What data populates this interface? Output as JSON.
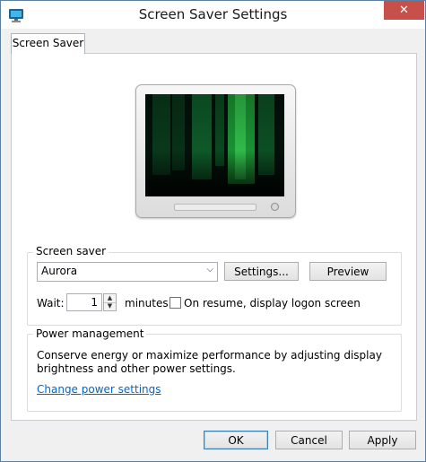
{
  "window": {
    "title": "Screen Saver Settings",
    "close_label": "✕"
  },
  "tabs": [
    {
      "label": "Screen Saver",
      "selected": true
    }
  ],
  "screen_saver": {
    "group_label": "Screen saver",
    "selected": "Aurora",
    "settings_label": "Settings...",
    "preview_label": "Preview",
    "wait_label": "Wait:",
    "wait_value": "1",
    "wait_unit": "minutes",
    "resume_label": "On resume, display logon screen",
    "resume_checked": false
  },
  "power": {
    "group_label": "Power management",
    "description_line1": "Conserve energy or maximize performance by adjusting display",
    "description_line2": "brightness and other power settings.",
    "link_label": "Change power settings"
  },
  "footer": {
    "ok_label": "OK",
    "cancel_label": "Cancel",
    "apply_label": "Apply"
  },
  "colors": {
    "close_button": "#c7504a",
    "link": "#0066cc",
    "aurora_green": "#1fa83a"
  }
}
